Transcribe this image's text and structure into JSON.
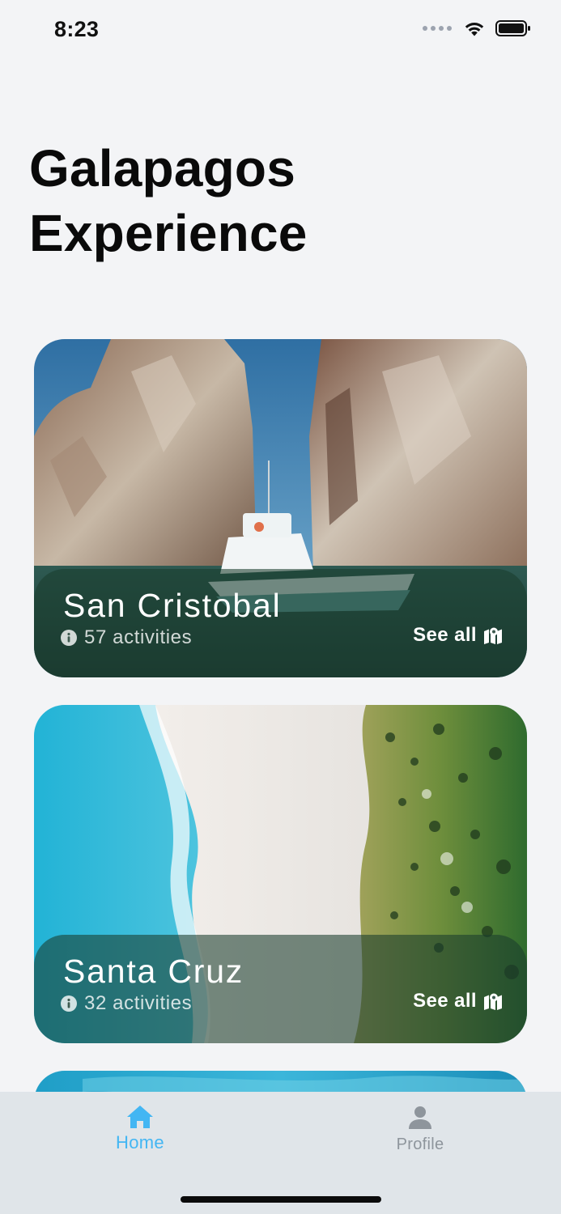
{
  "status_bar": {
    "time": "8:23"
  },
  "header": {
    "title_line1": "Galapagos",
    "title_line2": "Experience"
  },
  "cards": [
    {
      "name": "San Cristobal",
      "activities": "57 activities",
      "see_all_label": "See all"
    },
    {
      "name": "Santa Cruz",
      "activities": "32 activities",
      "see_all_label": "See all"
    }
  ],
  "tab_bar": {
    "tabs": [
      {
        "label": "Home",
        "icon": "home-icon",
        "active": true
      },
      {
        "label": "Profile",
        "icon": "person-icon",
        "active": false
      }
    ]
  },
  "colors": {
    "background": "#f3f4f6",
    "accent": "#43b6f3",
    "tab_bar": "#e0e5e9",
    "inactive": "#8e959c"
  },
  "icons": {
    "status": [
      "signal-dots-icon",
      "wifi-icon",
      "battery-icon"
    ],
    "card_meta": "info-icon",
    "see_all": "map-icon"
  }
}
